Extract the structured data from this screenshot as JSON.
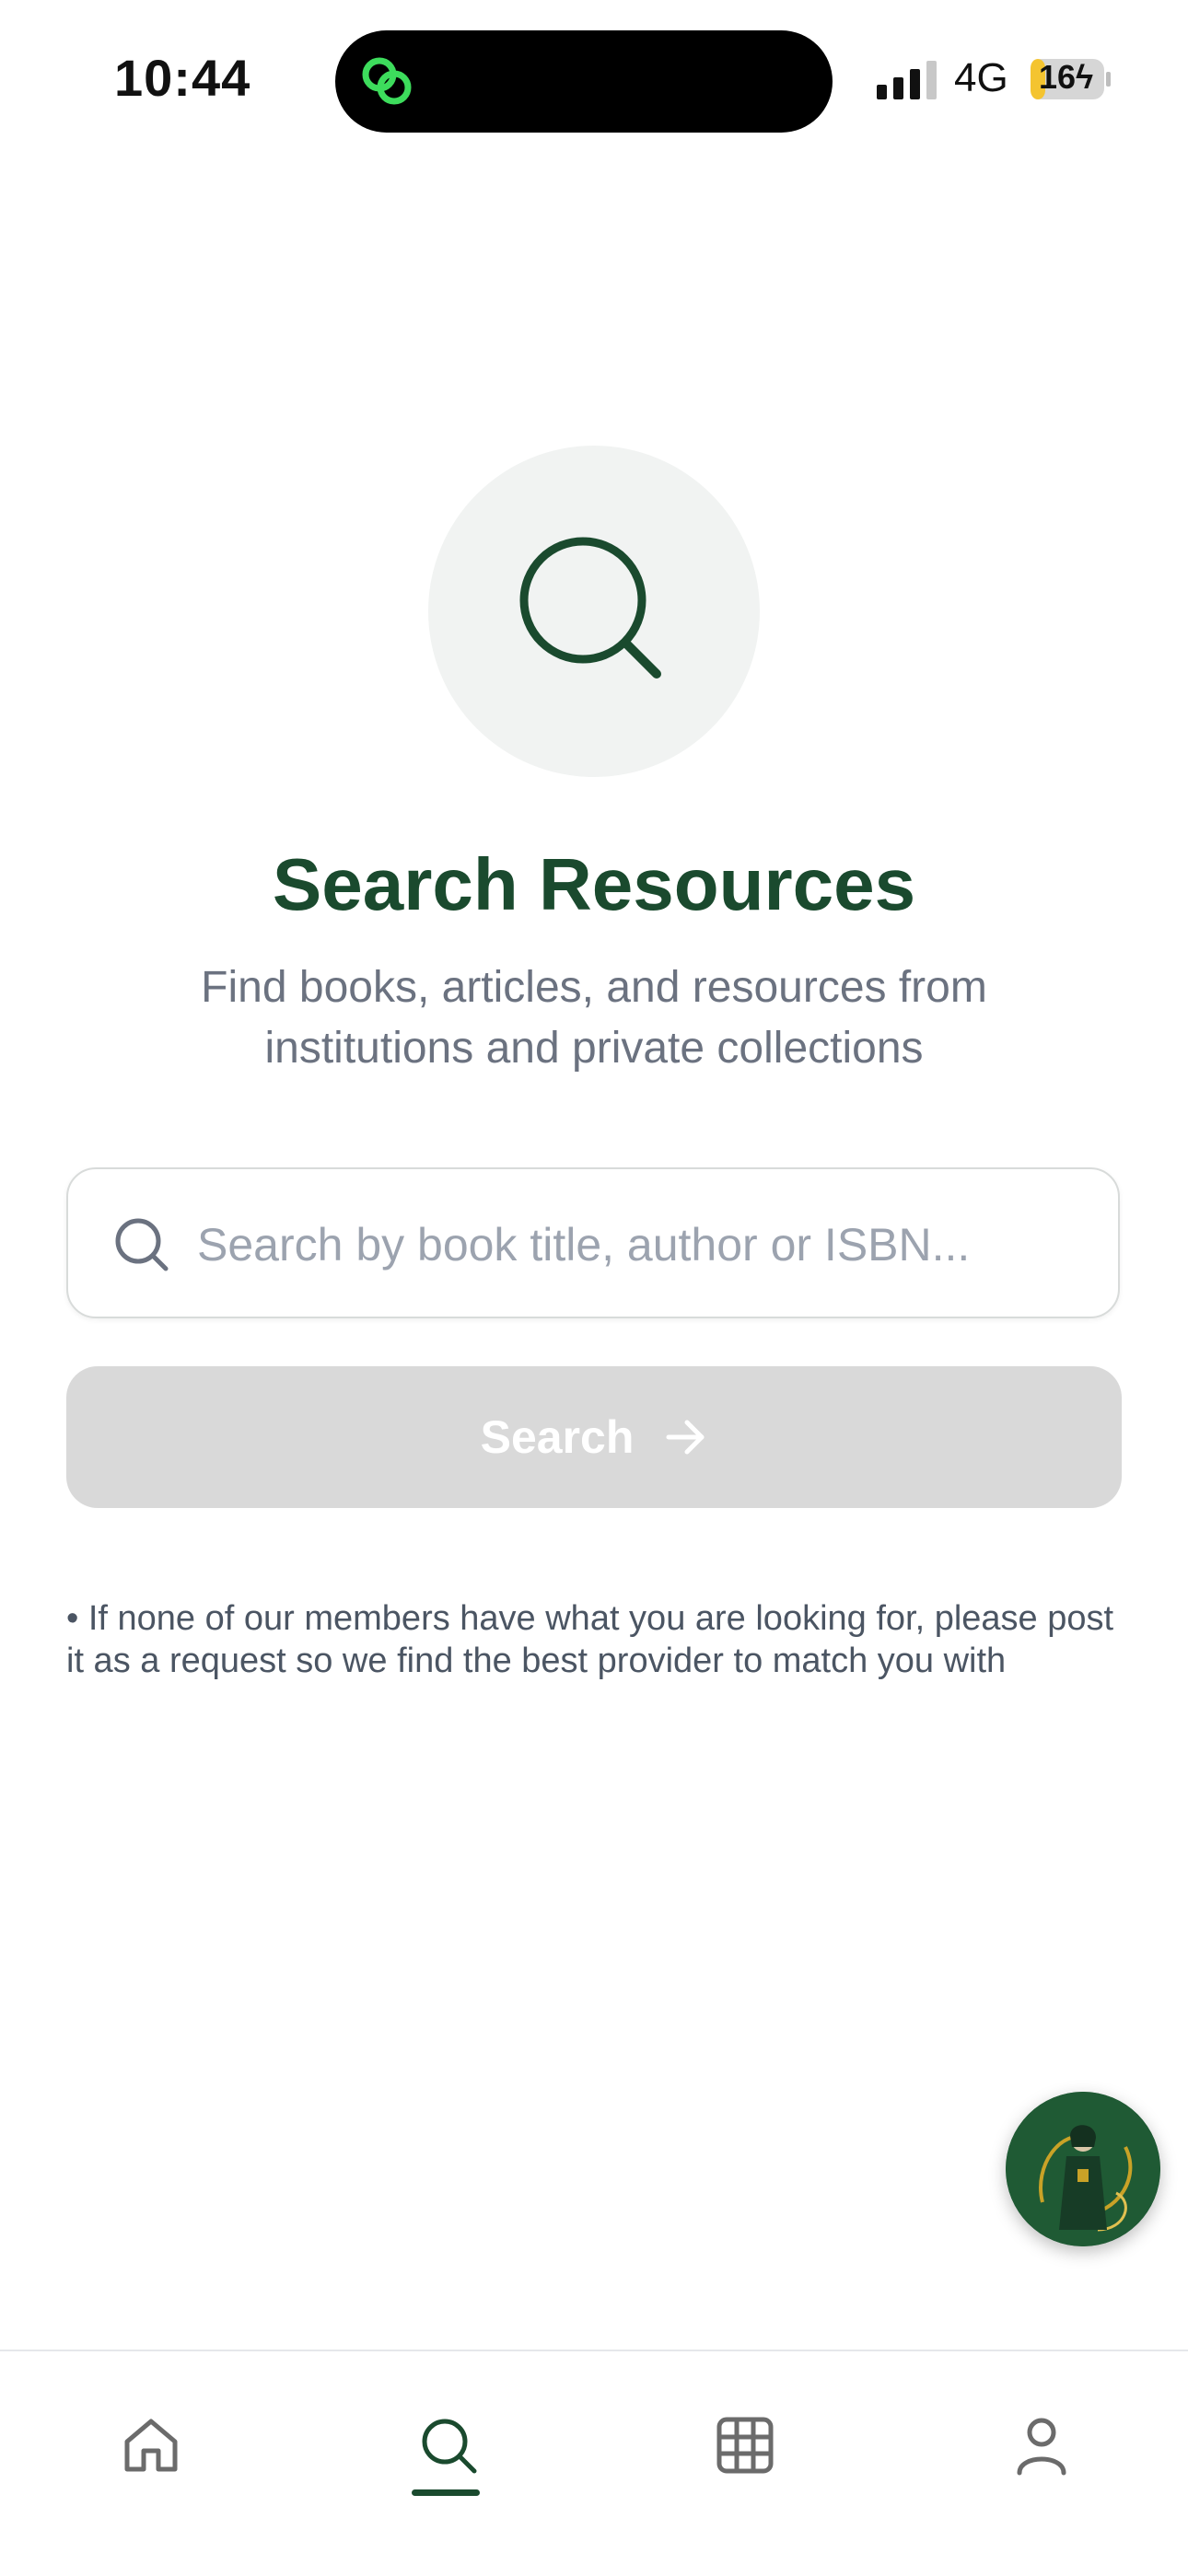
{
  "status_bar": {
    "time": "10:44",
    "network": "4G",
    "battery": "16"
  },
  "hero": {
    "icon": "search-icon",
    "title": "Search Resources",
    "subtitle": "Find books, articles, and resources from institutions and private collections"
  },
  "search": {
    "placeholder": "Search by book title, author or ISBN...",
    "value": "",
    "button_label": "Search",
    "button_enabled": false
  },
  "note": "• If none of our members have what you are looking for, please post it as a request so we find the best provider to match you with",
  "colors": {
    "brand_green": "#1a4a2e",
    "button_disabled": "#d9d9d9",
    "hero_circle": "#f1f3f2"
  },
  "bottom_nav": {
    "items": [
      {
        "icon": "home-icon",
        "active": false
      },
      {
        "icon": "search-icon",
        "active": true
      },
      {
        "icon": "grid-icon",
        "active": false
      },
      {
        "icon": "profile-icon",
        "active": false
      }
    ]
  }
}
